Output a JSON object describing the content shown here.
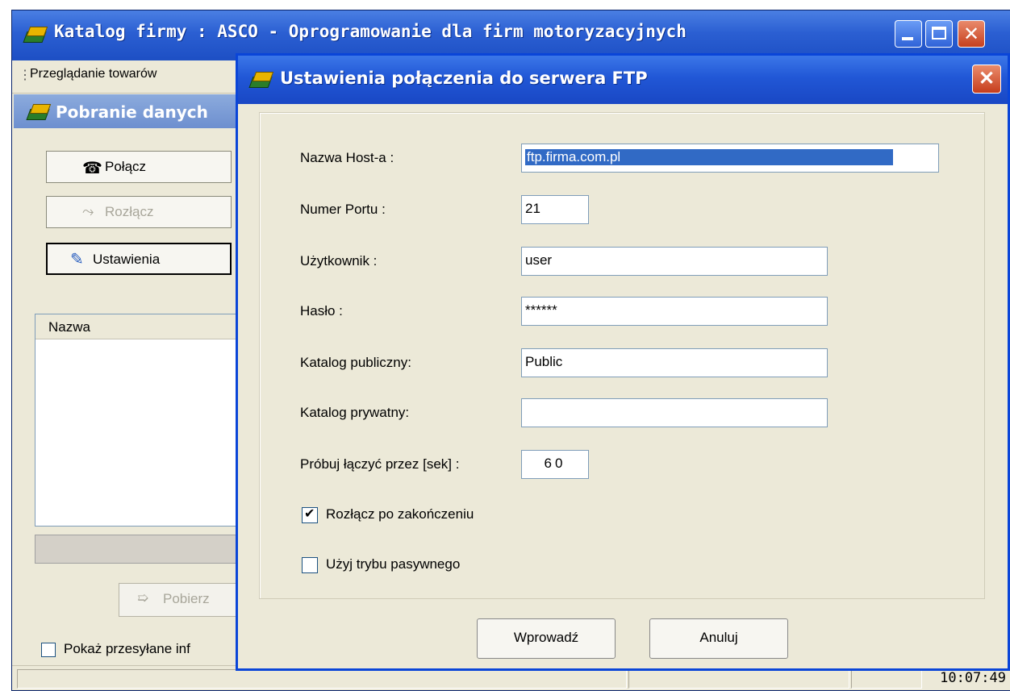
{
  "main_window": {
    "title": "Katalog firmy : ASCO - Oprogramowanie dla firm motoryzacyjnych",
    "menu_item": "Przeglądanie towarów",
    "child_title": "Pobranie danych",
    "buttons": {
      "connect": "Połącz",
      "disconnect": "Rozłącz",
      "settings": "Ustawienia",
      "download": "Pobierz"
    },
    "list_header": "Nazwa",
    "show_checkbox_label": "Pokaż przesyłane inf",
    "status_clock": "10:07:49"
  },
  "dialog": {
    "title": "Ustawienia połączenia do serwera FTP",
    "fields": {
      "host_label": "Nazwa Host-a :",
      "host_value": "ftp.firma.com.pl",
      "port_label": "Numer Portu  :",
      "port_value": "21",
      "user_label": "Użytkownik   :",
      "user_value": "user",
      "password_label": "Hasło        :",
      "password_value": "******",
      "public_label": "Katalog publiczny:",
      "public_value": "Public",
      "private_label": "Katalog prywatny:",
      "private_value": "",
      "timeout_label": "Próbuj łączyć przez [sek] :",
      "timeout_value": "60"
    },
    "checkboxes": {
      "disconnect_after": {
        "label": "Rozłącz po zakończeniu",
        "checked": true
      },
      "passive_mode": {
        "label": "Użyj trybu pasywnego",
        "checked": false
      }
    },
    "buttons": {
      "ok": "Wprowadź",
      "cancel": "Anuluj"
    }
  },
  "colors": {
    "xp_title_blue": "#2157d6",
    "xp_face": "#ece9d8",
    "selection": "#316ac5",
    "close_red": "#c63d1c"
  }
}
